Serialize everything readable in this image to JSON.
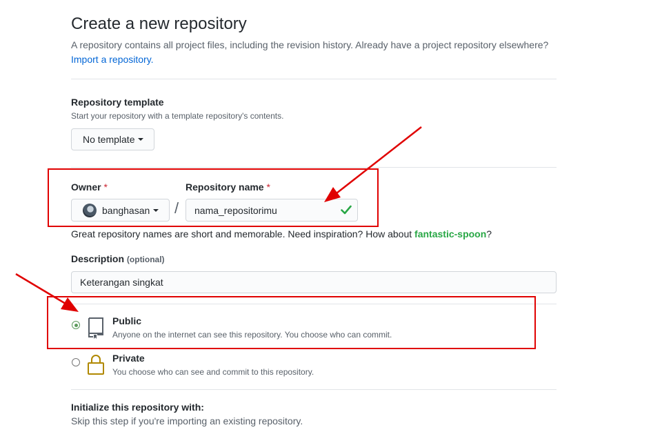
{
  "header": {
    "title": "Create a new repository",
    "intro": "A repository contains all project files, including the revision history. Already have a project repository elsewhere?",
    "import_link": "Import a repository."
  },
  "template": {
    "label": "Repository template",
    "note": "Start your repository with a template repository's contents.",
    "button": "No template"
  },
  "owner": {
    "label": "Owner",
    "required_mark": "*",
    "value": "banghasan"
  },
  "separator": "/",
  "repo_name": {
    "label": "Repository name",
    "required_mark": "*",
    "value": "nama_repositorimu"
  },
  "name_hint": {
    "prefix": "Great repository names are short and memorable. Need inspiration? How about",
    "suggestion": "fantastic-spoon",
    "suffix": "?"
  },
  "description": {
    "label": "Description",
    "optional": "(optional)",
    "value": "Keterangan singkat"
  },
  "visibility": {
    "public": {
      "title": "Public",
      "desc": "Anyone on the internet can see this repository. You choose who can commit.",
      "selected": true
    },
    "private": {
      "title": "Private",
      "desc": "You choose who can see and commit to this repository.",
      "selected": false
    }
  },
  "init": {
    "label": "Initialize this repository with:",
    "note": "Skip this step if you're importing an existing repository."
  },
  "colors": {
    "annotation": "#e00000",
    "link": "#0366d6",
    "success": "#28a745",
    "required": "#cb2431"
  }
}
